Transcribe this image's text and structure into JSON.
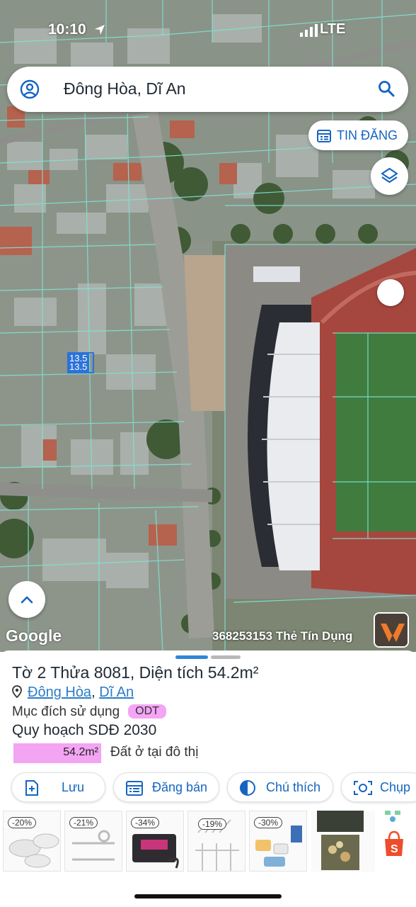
{
  "status_bar": {
    "time": "10:10",
    "network": "LTE"
  },
  "search": {
    "value": "Đông Hòa, Dĩ An"
  },
  "map_controls": {
    "tin_dang_label": "TIN ĐĂNG"
  },
  "map_labels": {
    "parcel_a": "13.5",
    "parcel_b": "13.5"
  },
  "map_footer": {
    "google": "Google",
    "ad_ticker": "368253153 Thẻ Tín Dụng"
  },
  "parcel": {
    "title": "Tờ 2 Thửa 8081, Diện tích 54.2m²",
    "ward": "Đông Hòa",
    "sep": ", ",
    "district": "Dĩ An",
    "purpose_label": "Mục đích sử dụng",
    "purpose_code": "ODT",
    "plan_label": "Quy hoạch SDĐ 2030",
    "area_value": "54.2m²",
    "area_desc": "Đất ở tại đô thị"
  },
  "actions": {
    "save": "Lưu",
    "post": "Đăng bán",
    "legend": "Chú thích",
    "capture": "Chụp"
  },
  "ads": [
    {
      "discount": "-20%"
    },
    {
      "discount": "-21%"
    },
    {
      "discount": "-34%"
    },
    {
      "discount": "-19%"
    },
    {
      "discount": "-30%"
    },
    {
      "discount": ""
    },
    {
      "discount": ""
    }
  ],
  "colors": {
    "accent": "#1565c0",
    "link": "#2a7cc7",
    "badge_pink": "#f4a5f5",
    "map_lines": "#7fe3d2"
  }
}
